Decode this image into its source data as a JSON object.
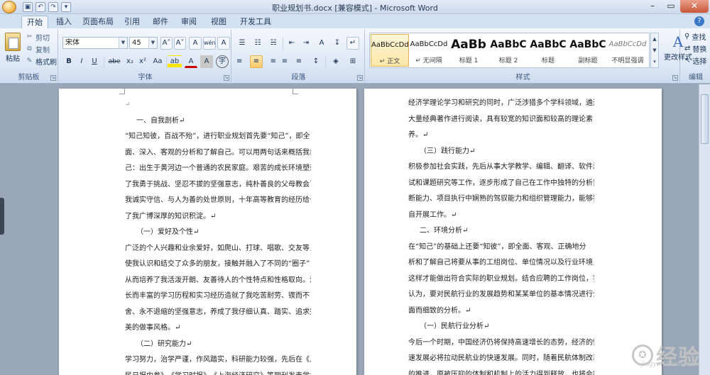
{
  "window": {
    "title": "职业规划书.docx [兼容模式] - Microsoft Word",
    "minimize": "–",
    "restore": "▭",
    "close": "✕"
  },
  "qat": {
    "save": "▣",
    "undo": "↶",
    "redo": "↷",
    "more": "▾"
  },
  "tabs": [
    {
      "label": "开始",
      "active": true
    },
    {
      "label": "插入"
    },
    {
      "label": "页面布局"
    },
    {
      "label": "引用"
    },
    {
      "label": "邮件"
    },
    {
      "label": "审阅"
    },
    {
      "label": "视图"
    },
    {
      "label": "开发工具"
    }
  ],
  "help": "?",
  "clipboard": {
    "paste": "粘贴",
    "cut": "剪切",
    "copy": "复制",
    "format_painter": "格式刷",
    "label": "剪贴板"
  },
  "font": {
    "name": "宋体",
    "size": "45",
    "grow": "A˄",
    "shrink": "A˅",
    "clear": "A",
    "phonetic": "wén",
    "border_char": "A",
    "bold": "B",
    "italic": "I",
    "underline": "U",
    "strike": "abe",
    "subscript": "x₂",
    "superscript": "x²",
    "case": "Aa",
    "highlight": "ab",
    "color": "A",
    "shade": "A",
    "enclose": "字",
    "label": "字体"
  },
  "paragraph": {
    "bullets": "☰",
    "numbering": "☷",
    "multilevel": "☵",
    "decrease_indent": "⇤",
    "increase_indent": "⇥",
    "chinese_layout": "A",
    "sort": "↧",
    "show_marks": "↵",
    "align_left": "≡",
    "align_center": "≡",
    "align_right": "≡",
    "justify": "≡",
    "distributed": "≡",
    "line_spacing": "↕",
    "shading": "◈",
    "borders": "⊞",
    "label": "段落"
  },
  "styles": {
    "tiles": [
      {
        "sample": "AaBbCcDd",
        "name": "↵ 正文",
        "selected": true
      },
      {
        "sample": "AaBbCcDd",
        "name": "↵ 无间隔"
      },
      {
        "sample": "AaBb",
        "name": "标题 1"
      },
      {
        "sample": "AaBbC",
        "name": "标题 2"
      },
      {
        "sample": "AaBbC",
        "name": "标题"
      },
      {
        "sample": "AaBbC",
        "name": "副标题"
      },
      {
        "sample": "AaBbCcDd",
        "name": "不明显强调"
      }
    ],
    "change_icon": "A",
    "change_label": "更改样式",
    "label": "样式"
  },
  "editing": {
    "find": "查找",
    "replace": "替换",
    "select": "选择",
    "label": "编辑"
  },
  "document": {
    "left_page": [
      {
        "text": "↵",
        "kind": "mark"
      },
      {
        "text": "一、自我剖析↵",
        "kind": "heading"
      },
      {
        "text": "“知己知彼，百战不殆”，进行职业规划首先要“知己”，即全",
        "kind": "line"
      },
      {
        "text": "面、深入、客观的分析和了解自己。可以用两句话来概括我自",
        "kind": "line"
      },
      {
        "text": "己：出生于黄河边一个普通的农民家庭。艰苦的成长环境塑造",
        "kind": "line"
      },
      {
        "text": "了我勇于挑战、坚忍不拔的坚强意志，纯朴善良的父母教会了",
        "kind": "line"
      },
      {
        "text": "我诚实守信、与人为善的处世原则，十年高等教育的经历给予",
        "kind": "line"
      },
      {
        "text": "了我广博深厚的知识积淀。↵",
        "kind": "line"
      },
      {
        "text": "（一）爱好及个性↵",
        "kind": "heading"
      },
      {
        "text": "广泛的个人兴趣和业余爱好，如爬山、打球、唱歌、交友等，",
        "kind": "line"
      },
      {
        "text": "使我认识和结交了众多的朋友，接触并融入了不同的“圈子”，",
        "kind": "line"
      },
      {
        "text": "从而培养了我活泼开朗、友善待人的个性特点和性格取向。漫",
        "kind": "line"
      },
      {
        "text": "长而丰富的学习历程和实习经历造就了我吃苦耐劳、锲而不",
        "kind": "line"
      },
      {
        "text": "舍、永不退缩的坚强意志，养成了我仔细认真、踏实、追求完",
        "kind": "line"
      },
      {
        "text": "美的做事风格。↵",
        "kind": "line"
      },
      {
        "text": "（二）研究能力↵",
        "kind": "heading"
      },
      {
        "text": "学习努力，治学严谨，作风踏实，科研能力较强，先后在《人",
        "kind": "line"
      },
      {
        "text": "民日报内参》、《学习时报》、《上海经济研究》等期刊发表学术",
        "kind": "line"
      }
    ],
    "right_page": [
      {
        "text": "经济学理论学习和研究的同时，广泛涉猎多个学科领域，遴选",
        "kind": "line"
      },
      {
        "text": "大量经典著作进行阅读，具有较宽的知识面和较高的理论素",
        "kind": "line"
      },
      {
        "text": "养。↵",
        "kind": "line"
      },
      {
        "text": "（三）践行能力↵",
        "kind": "heading"
      },
      {
        "text": "积极参加社会实践，先后从事大学教学、编辑、翻译、软件测",
        "kind": "line"
      },
      {
        "text": "试和课题研究等工作，逐步形成了自己在工作中独特的分析判",
        "kind": "line"
      },
      {
        "text": "断能力、项目执行中娴熟的驾驭能力和组织管理能力，能够独",
        "kind": "line"
      },
      {
        "text": "自开展工作。↵",
        "kind": "line"
      },
      {
        "text": "二、环境分析↵",
        "kind": "heading"
      },
      {
        "text": "在“知己”的基础上还要“知彼”，即全面、客观、正确地分",
        "kind": "line"
      },
      {
        "text": "析和了解自己将要从事的工组岗位、单位情况以及行业环境，",
        "kind": "line"
      },
      {
        "text": "这样才能做出符合实际的职业规划。结合应聘的工作岗位，我",
        "kind": "line"
      },
      {
        "text": "认为，要对民航行业的发展趋势和某某单位的基本情况进行全",
        "kind": "line"
      },
      {
        "text": "面而细致的分析。↵",
        "kind": "line"
      },
      {
        "text": "（一）民航行业分析↵",
        "kind": "heading"
      },
      {
        "text": "今后一个时期，中国经济仍将保持高速增长的态势，经济的快",
        "kind": "line"
      },
      {
        "text": "速发展必将拉动民航业的快速发展。同时，随着民航体制改革",
        "kind": "line"
      },
      {
        "text": "的推进，原被压抑的体制和机制上的活力得到释放，也将会推",
        "kind": "line"
      }
    ]
  },
  "watermark": {
    "logo": "Bai",
    "text": "经验",
    "sub": "jingyan.baidu.com"
  }
}
